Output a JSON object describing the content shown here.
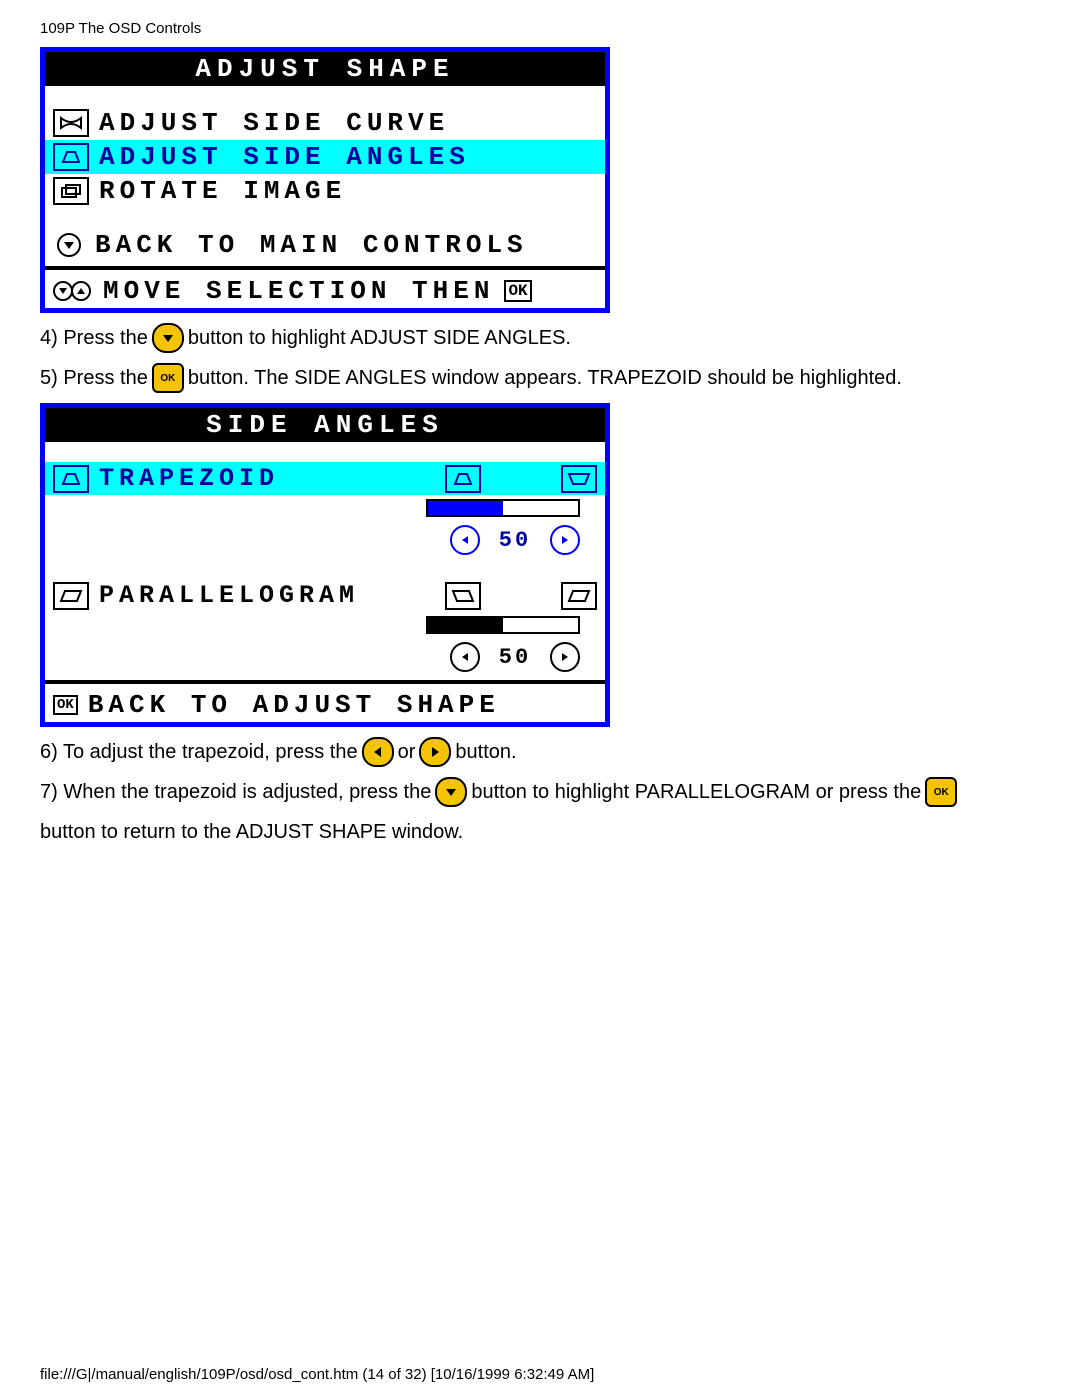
{
  "header": "109P The OSD Controls",
  "osd1": {
    "title": "ADJUST SHAPE",
    "items": [
      "ADJUST SIDE CURVE",
      "ADJUST SIDE ANGLES",
      "ROTATE IMAGE"
    ],
    "back": "BACK TO MAIN CONTROLS",
    "hint": "MOVE SELECTION THEN"
  },
  "step4a": "4) Press the",
  "step4b": "button to highlight ADJUST SIDE ANGLES.",
  "step5a": "5) Press the",
  "step5b": "button. The SIDE ANGLES window appears. TRAPEZOID should be highlighted.",
  "osd2": {
    "title": "SIDE ANGLES",
    "trap": "TRAPEZOID",
    "trapval": "50",
    "para": "PARALLELOGRAM",
    "paraval": "50",
    "back": "BACK TO ADJUST SHAPE"
  },
  "step6a": "6) To adjust the trapezoid, press the",
  "step6b": "or",
  "step6c": "button.",
  "step7a": "7) When the trapezoid is adjusted, press the",
  "step7b": "button to highlight PARALLELOGRAM or press the",
  "step7c": "button to return to the ADJUST SHAPE window.",
  "footer": "file:///G|/manual/english/109P/osd/osd_cont.htm (14 of 32) [10/16/1999 6:32:49 AM]"
}
